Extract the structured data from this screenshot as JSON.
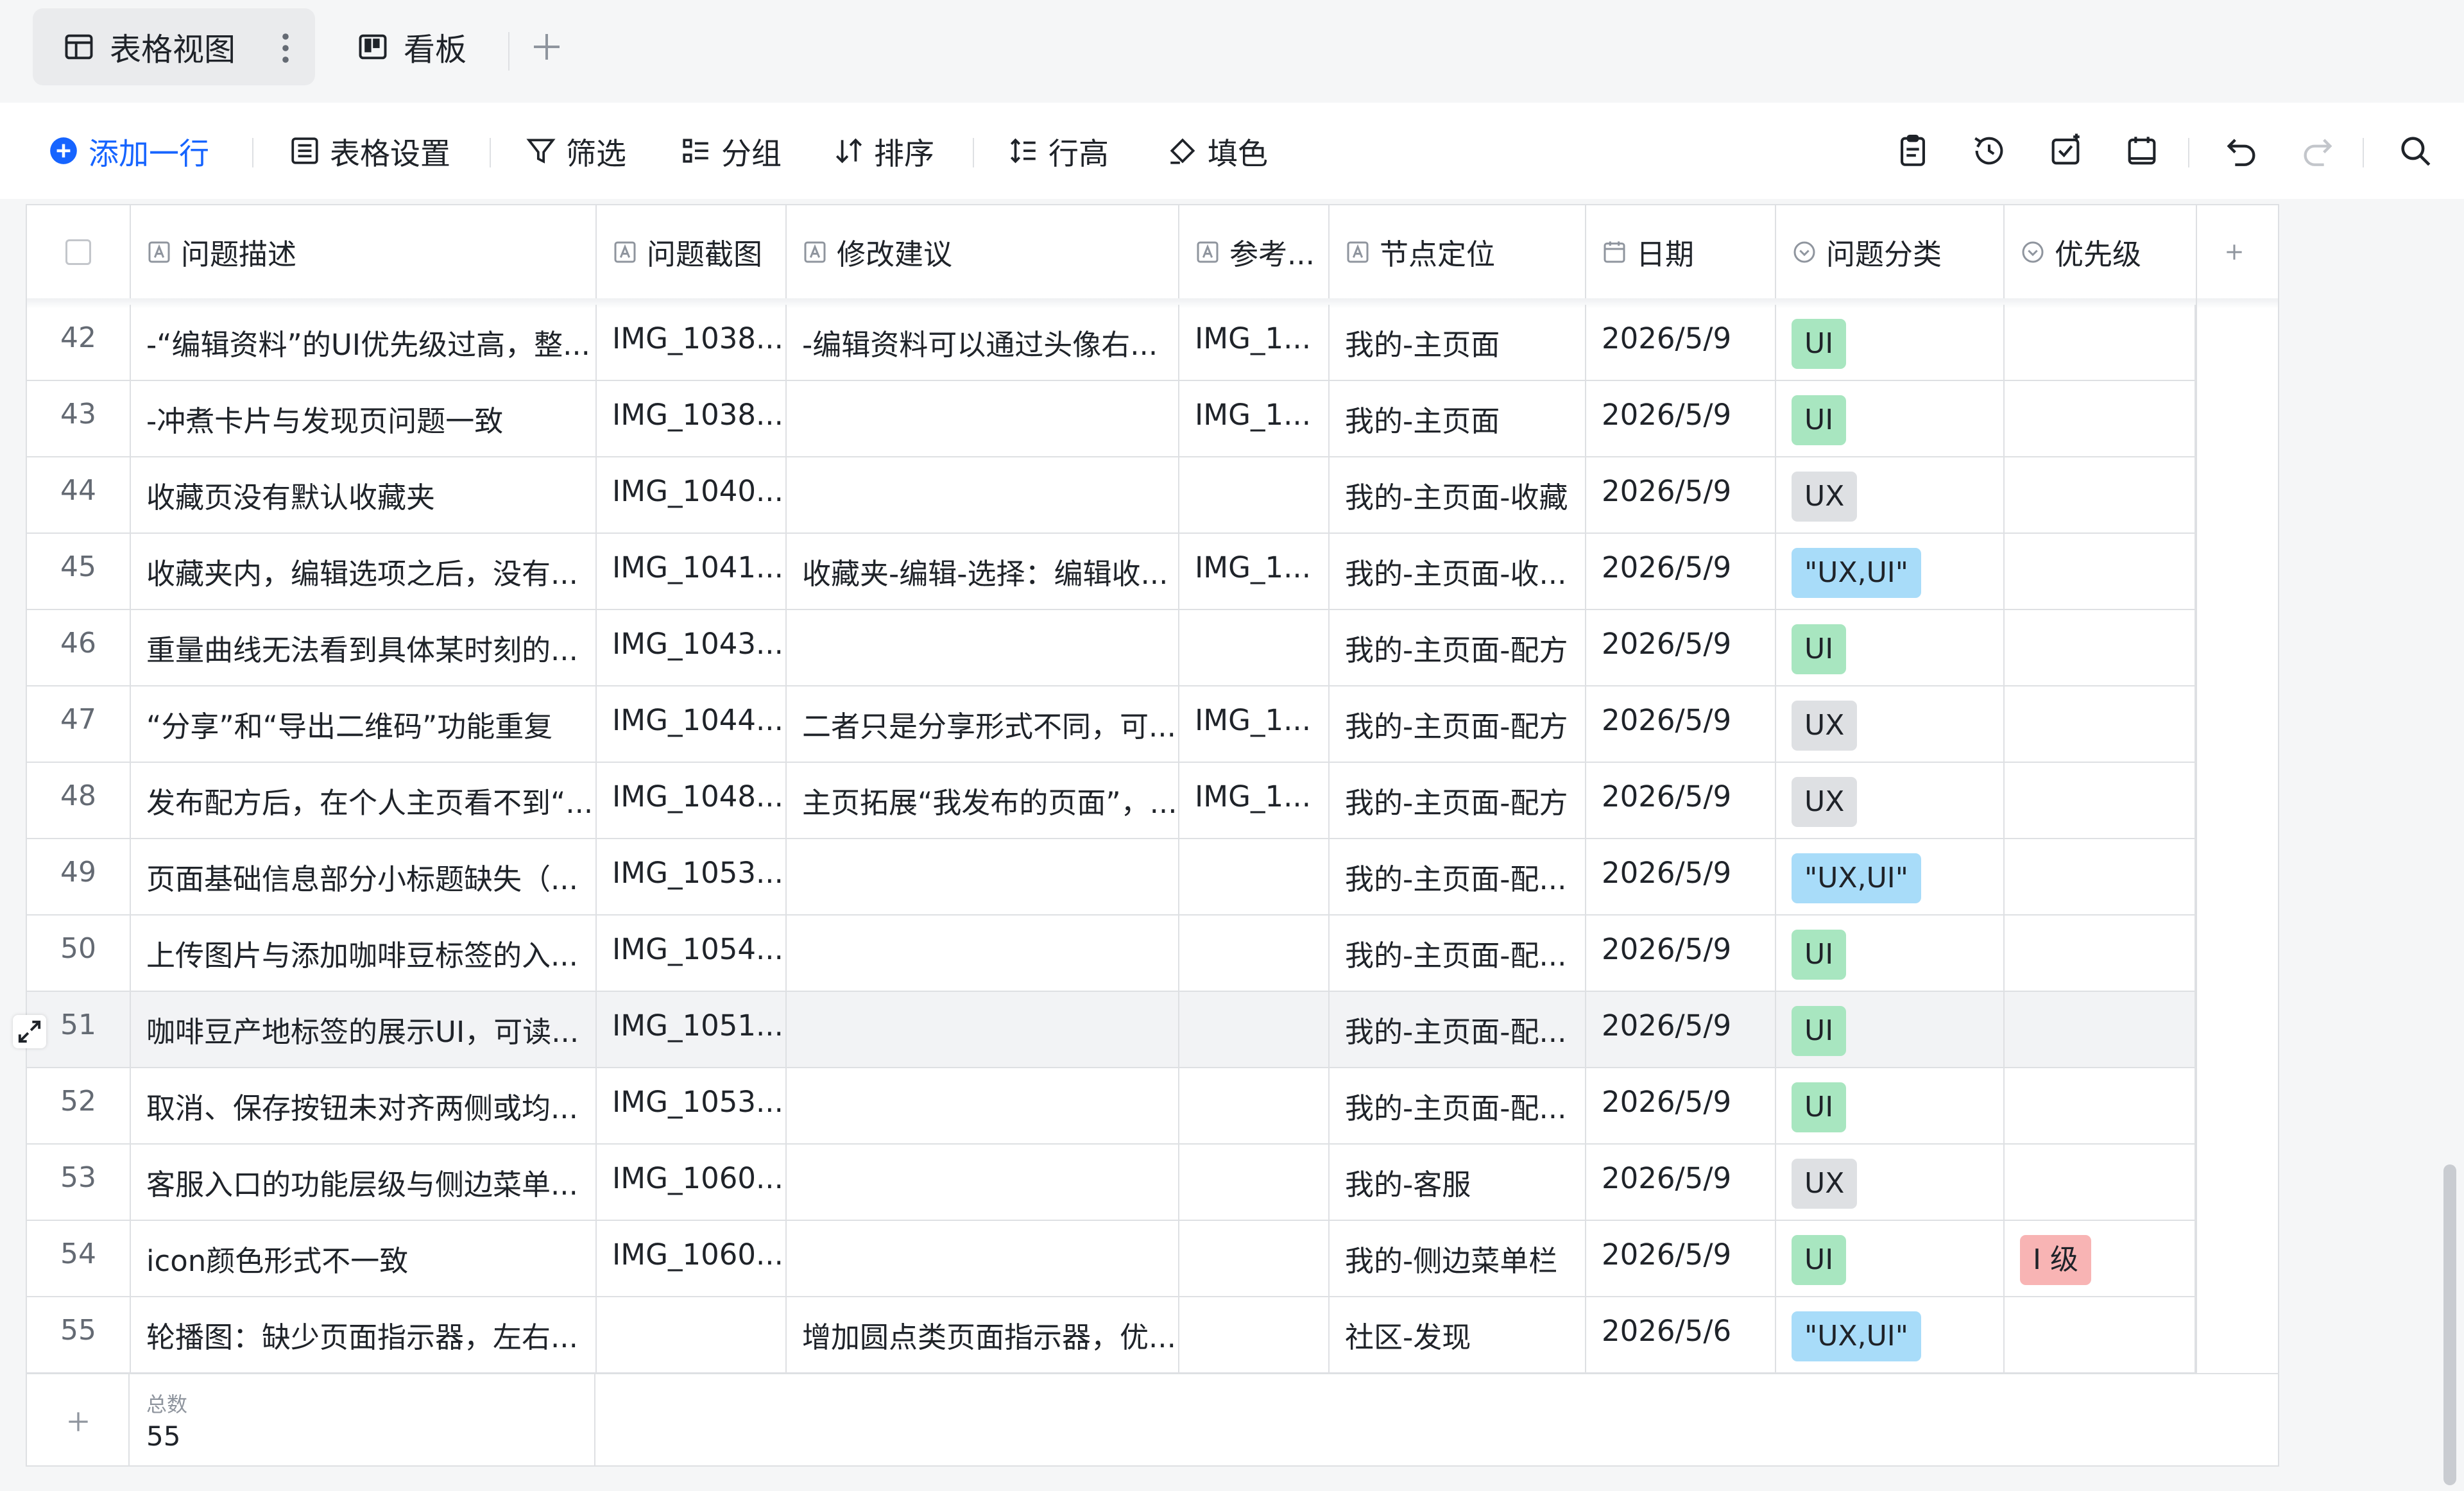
{
  "views": [
    {
      "label": "表格视图",
      "icon": "table-icon",
      "active": true
    },
    {
      "label": "看板",
      "icon": "kanban-icon",
      "active": false
    }
  ],
  "toolbar": {
    "add_row": "添加一行",
    "settings": "表格设置",
    "filter": "筛选",
    "group": "分组",
    "sort": "排序",
    "row_height": "行高",
    "fill_color": "填色",
    "right_icons": [
      "clipboard-icon",
      "history-icon",
      "check-task-icon",
      "calendar-icon",
      "undo-icon",
      "redo-icon",
      "search-icon"
    ]
  },
  "columns": [
    "问题描述",
    "问题截图",
    "修改建议",
    "参考...",
    "节点定位",
    "日期",
    "问题分类",
    "优先级"
  ],
  "rows": [
    {
      "n": "42",
      "desc": "-“编辑资料”的UI优先级过高，整...",
      "shot": "IMG_1038...",
      "sugg": "-编辑资料可以通过头像右...",
      "ref": "IMG_1...",
      "node": "我的-主页面",
      "date": "2026/5/9",
      "cat": "UI",
      "prio": ""
    },
    {
      "n": "43",
      "desc": "-冲煮卡片与发现页问题一致",
      "shot": "IMG_1038...",
      "sugg": "",
      "ref": "IMG_1...",
      "node": "我的-主页面",
      "date": "2026/5/9",
      "cat": "UI",
      "prio": ""
    },
    {
      "n": "44",
      "desc": "收藏页没有默认收藏夹",
      "shot": "IMG_1040...",
      "sugg": "",
      "ref": "",
      "node": "我的-主页面-收藏",
      "date": "2026/5/9",
      "cat": "UX",
      "prio": ""
    },
    {
      "n": "45",
      "desc": "收藏夹内，编辑选项之后，没有...",
      "shot": "IMG_1041...",
      "sugg": "收藏夹-编辑-选择：编辑收...",
      "ref": "IMG_1...",
      "node": "我的-主页面-收...",
      "date": "2026/5/9",
      "cat": "\"UX,UI\"",
      "prio": ""
    },
    {
      "n": "46",
      "desc": "重量曲线无法看到具体某时刻的...",
      "shot": "IMG_1043...",
      "sugg": "",
      "ref": "",
      "node": "我的-主页面-配方",
      "date": "2026/5/9",
      "cat": "UI",
      "prio": ""
    },
    {
      "n": "47",
      "desc": "“分享”和“导出二维码”功能重复",
      "shot": "IMG_1044...",
      "sugg": "二者只是分享形式不同，可...",
      "ref": "IMG_1...",
      "node": "我的-主页面-配方",
      "date": "2026/5/9",
      "cat": "UX",
      "prio": ""
    },
    {
      "n": "48",
      "desc": "发布配方后，在个人主页看不到“...",
      "shot": "IMG_1048...",
      "sugg": "主页拓展“我发布的页面”，...",
      "ref": "IMG_1...",
      "node": "我的-主页面-配方",
      "date": "2026/5/9",
      "cat": "UX",
      "prio": ""
    },
    {
      "n": "49",
      "desc": "页面基础信息部分小标题缺失（...",
      "shot": "IMG_1053...",
      "sugg": "",
      "ref": "",
      "node": "我的-主页面-配...",
      "date": "2026/5/9",
      "cat": "\"UX,UI\"",
      "prio": ""
    },
    {
      "n": "50",
      "desc": "上传图片与添加咖啡豆标签的入...",
      "shot": "IMG_1054...",
      "sugg": "",
      "ref": "",
      "node": "我的-主页面-配...",
      "date": "2026/5/9",
      "cat": "UI",
      "prio": ""
    },
    {
      "n": "51",
      "desc": "咖啡豆产地标签的展示UI，可读...",
      "shot": "IMG_1051...",
      "sugg": "",
      "ref": "",
      "node": "我的-主页面-配...",
      "date": "2026/5/9",
      "cat": "UI",
      "prio": ""
    },
    {
      "n": "52",
      "desc": "取消、保存按钮未对齐两侧或均...",
      "shot": "IMG_1053...",
      "sugg": "",
      "ref": "",
      "node": "我的-主页面-配...",
      "date": "2026/5/9",
      "cat": "UI",
      "prio": ""
    },
    {
      "n": "53",
      "desc": "客服入口的功能层级与侧边菜单...",
      "shot": "IMG_1060...",
      "sugg": "",
      "ref": "",
      "node": "我的-客服",
      "date": "2026/5/9",
      "cat": "UX",
      "prio": ""
    },
    {
      "n": "54",
      "desc": "icon颜色形式不一致",
      "shot": "IMG_1060...",
      "sugg": "",
      "ref": "",
      "node": "我的-侧边菜单栏",
      "date": "2026/5/9",
      "cat": "UI",
      "prio": "I 级"
    },
    {
      "n": "55",
      "desc": "轮播图：缺少页面指示器，左右...",
      "shot": "",
      "sugg": "增加圆点类页面指示器，优...",
      "ref": "",
      "node": "社区-发现",
      "date": "2026/5/6",
      "cat": "\"UX,UI\"",
      "prio": ""
    }
  ],
  "footer": {
    "total_label": "总数",
    "total_value": "55"
  },
  "colors": {
    "accent": "#1664ff",
    "tag_ui": "#a8e6c0",
    "tag_ux": "#dee0e3",
    "tag_uxui": "#a8dcf9",
    "tag_prio": "#f8b4b4"
  }
}
